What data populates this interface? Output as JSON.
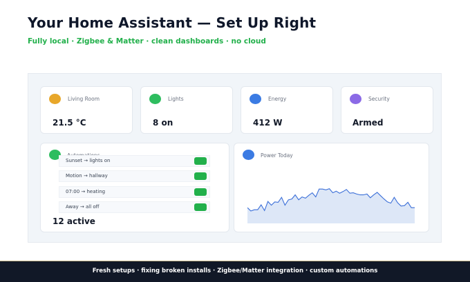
{
  "page": {
    "title": "Your Home Assistant — Set Up Right",
    "subtitle": "Fully local · Zigbee & Matter · clean dashboards · no cloud"
  },
  "cards": [
    {
      "label": "Living Room",
      "value": "21.5 °C",
      "color": "#e8a72a",
      "icon": "thermometer-icon"
    },
    {
      "label": "Lights",
      "value": "8 on",
      "color": "#2ebd5f",
      "icon": "light-bulb-icon"
    },
    {
      "label": "Energy",
      "value": "412 W",
      "color": "#3b7be3",
      "icon": "bolt-icon"
    },
    {
      "label": "Security",
      "value": "Armed",
      "color": "#8b6ae6",
      "icon": "shield-icon"
    }
  ],
  "automations": {
    "label": "Automations",
    "color": "#2ebd5f",
    "icon": "automation-icon",
    "items": [
      {
        "label": "Sunset → lights on",
        "enabled": true
      },
      {
        "label": "Motion → hallway",
        "enabled": true
      },
      {
        "label": "07:00 → heating",
        "enabled": true
      },
      {
        "label": "Away → all off",
        "enabled": true
      }
    ],
    "count": "12 active"
  },
  "power_today": {
    "label": "Power Today",
    "color": "#3b7be3",
    "icon": "power-icon",
    "line_color": "#3b6fd8",
    "fill_color": "#dde7f7",
    "levels": [
      0.38,
      0.3,
      0.33,
      0.33,
      0.45,
      0.31,
      0.53,
      0.44,
      0.52,
      0.51,
      0.63,
      0.44,
      0.57,
      0.59,
      0.69,
      0.57,
      0.64,
      0.61,
      0.68,
      0.74,
      0.64,
      0.83,
      0.83,
      0.81,
      0.84,
      0.74,
      0.78,
      0.73,
      0.77,
      0.82,
      0.73,
      0.74,
      0.71,
      0.69,
      0.69,
      0.71,
      0.62,
      0.69,
      0.75,
      0.67,
      0.59,
      0.52,
      0.49,
      0.63,
      0.5,
      0.42,
      0.43,
      0.51,
      0.38,
      0.38
    ]
  },
  "footer": {
    "text": "Fresh setups · fixing broken installs · Zigbee/Matter integration · custom automations"
  }
}
